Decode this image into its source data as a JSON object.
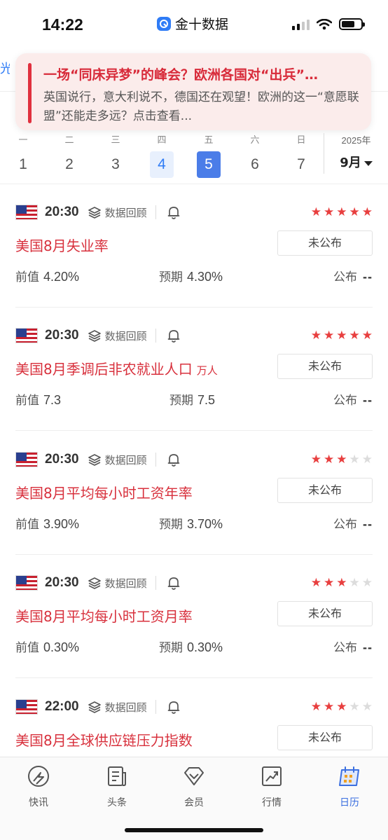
{
  "status_bar": {
    "time": "14:22",
    "app_name": "金十数据"
  },
  "banner": {
    "title": "一场“同床异梦”的峰会？欧洲各国对“出兵”…",
    "body": "英国说行，意大利说不，德国还在观望！欧洲的这一“意愿联盟”还能走多远？点击查看..."
  },
  "hidden_tab_fragment": "光",
  "week": {
    "days": [
      {
        "weekday": "一",
        "date": "1"
      },
      {
        "weekday": "二",
        "date": "2"
      },
      {
        "weekday": "三",
        "date": "3"
      },
      {
        "weekday": "四",
        "date": "4"
      },
      {
        "weekday": "五",
        "date": "5"
      },
      {
        "weekday": "六",
        "date": "6"
      },
      {
        "weekday": "日",
        "date": "7"
      }
    ],
    "today_index": 3,
    "selected_index": 4,
    "year": "2025年",
    "month": "9月"
  },
  "labels": {
    "review": "数据回顾",
    "prev": "前值",
    "forecast": "预期",
    "actual": "公布"
  },
  "events": [
    {
      "time": "20:30",
      "title": "美国8月失业率",
      "unit": "",
      "stars": 5,
      "status": "未公布",
      "prev": "4.20%",
      "forecast": "4.30%",
      "actual": "--"
    },
    {
      "time": "20:30",
      "title": "美国8月季调后非农就业人口",
      "unit": "万人",
      "stars": 5,
      "status": "未公布",
      "prev": "7.3",
      "forecast": "7.5",
      "actual": "--"
    },
    {
      "time": "20:30",
      "title": "美国8月平均每小时工资年率",
      "unit": "",
      "stars": 3,
      "status": "未公布",
      "prev": "3.90%",
      "forecast": "3.70%",
      "actual": "--"
    },
    {
      "time": "20:30",
      "title": "美国8月平均每小时工资月率",
      "unit": "",
      "stars": 3,
      "status": "未公布",
      "prev": "0.30%",
      "forecast": "0.30%",
      "actual": "--"
    },
    {
      "time": "22:00",
      "title": "美国8月全球供应链压力指数",
      "unit": "",
      "stars": 3,
      "status": "未公布",
      "prev": "",
      "forecast": "",
      "actual": ""
    }
  ],
  "tabs": [
    {
      "label": "快讯",
      "icon": "flash-news-icon"
    },
    {
      "label": "头条",
      "icon": "headline-icon"
    },
    {
      "label": "会员",
      "icon": "member-icon"
    },
    {
      "label": "行情",
      "icon": "market-icon"
    },
    {
      "label": "日历",
      "icon": "calendar-icon"
    }
  ],
  "active_tab_index": 4,
  "colors": {
    "accent_red": "#d8313d",
    "accent_blue": "#3b6fe0",
    "star_red": "#e83f3f"
  }
}
